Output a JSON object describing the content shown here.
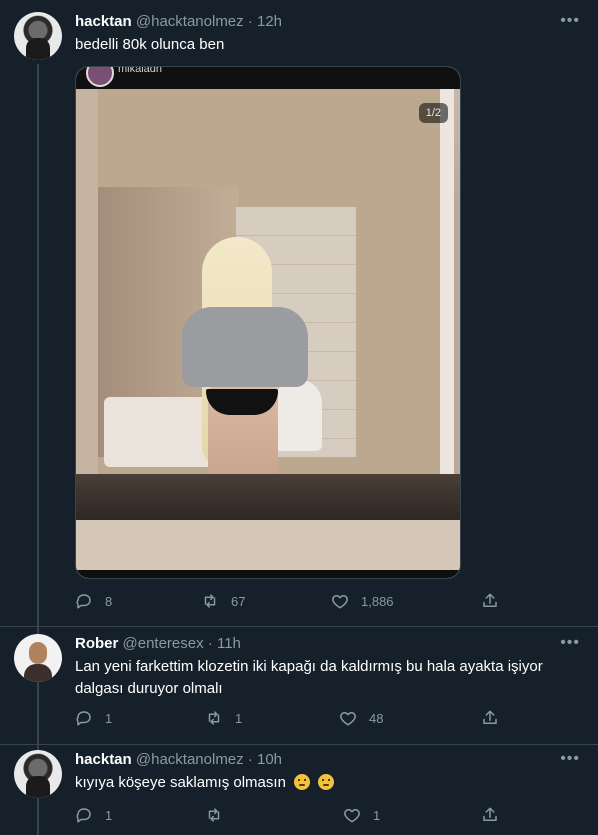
{
  "tweets": [
    {
      "name": "hacktan",
      "handle": "@hacktanolmez",
      "time": "· 12h",
      "text": "bedelli 80k olunca ben",
      "media": {
        "counter": "1/2",
        "embedded_user": "mikaladh"
      },
      "actions": {
        "reply": "8",
        "retweet": "67",
        "like": "1,886"
      }
    },
    {
      "name": "Rober",
      "handle": "@enteresex",
      "time": "· 11h",
      "text": "Lan yeni farkettim klozetin iki kapağı da kaldırmış bu hala ayakta işiyor dalgası duruyor olmalı",
      "actions": {
        "reply": "1",
        "retweet": "1",
        "like": "48"
      }
    },
    {
      "name": "hacktan",
      "handle": "@hacktanolmez",
      "time": "· 10h",
      "text": "kıyıya köşeye saklamış olmasın",
      "emoji": "🤔🤔",
      "actions": {
        "reply": "1",
        "retweet": "",
        "like": "1"
      }
    }
  ],
  "icons": {
    "more": "more-icon",
    "reply": "reply-icon",
    "retweet": "retweet-icon",
    "like": "like-icon",
    "share": "share-icon"
  },
  "colors": {
    "background": "#15202b",
    "muted": "#8b98a5",
    "divider": "#38444d"
  }
}
